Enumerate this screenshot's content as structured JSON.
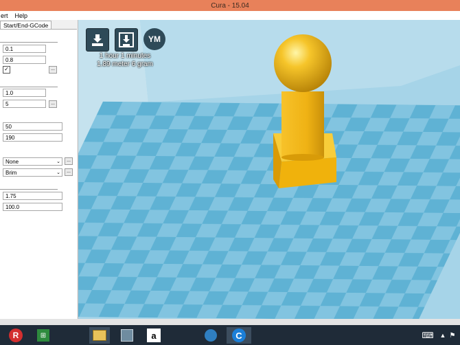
{
  "window": {
    "title": "Cura - 15.04"
  },
  "menu": {
    "items": [
      "ert",
      "Help"
    ]
  },
  "tab": {
    "label": "Start/End-GCode"
  },
  "settings": {
    "field1": "0.1",
    "field2": "0.8",
    "check1": "✓",
    "field3": "1.0",
    "field4": "5",
    "field5": "50",
    "field6": "190",
    "select1": "None",
    "select2": "Brim",
    "field7": "1.75",
    "field8": "100.0",
    "dots": "..."
  },
  "viewport": {
    "toolbar": {
      "ym_label": "YM"
    },
    "print_time": "1 hour 1 minutes",
    "material": "1.89 meter 6 gram"
  },
  "taskbar": {
    "r_label": "R",
    "store_label": "⊞",
    "amazon_label": "a",
    "cura_label": "C",
    "keyboard_icon": "⌨",
    "arrow_icon": "▲",
    "flag_icon": "⚑"
  },
  "colors": {
    "title_bar": "#e8815a",
    "viewport_bg": "#a6d4e8",
    "grid_dark": "#5fb2d4",
    "grid_light": "#82c4e0",
    "model": "#f2b81c"
  }
}
